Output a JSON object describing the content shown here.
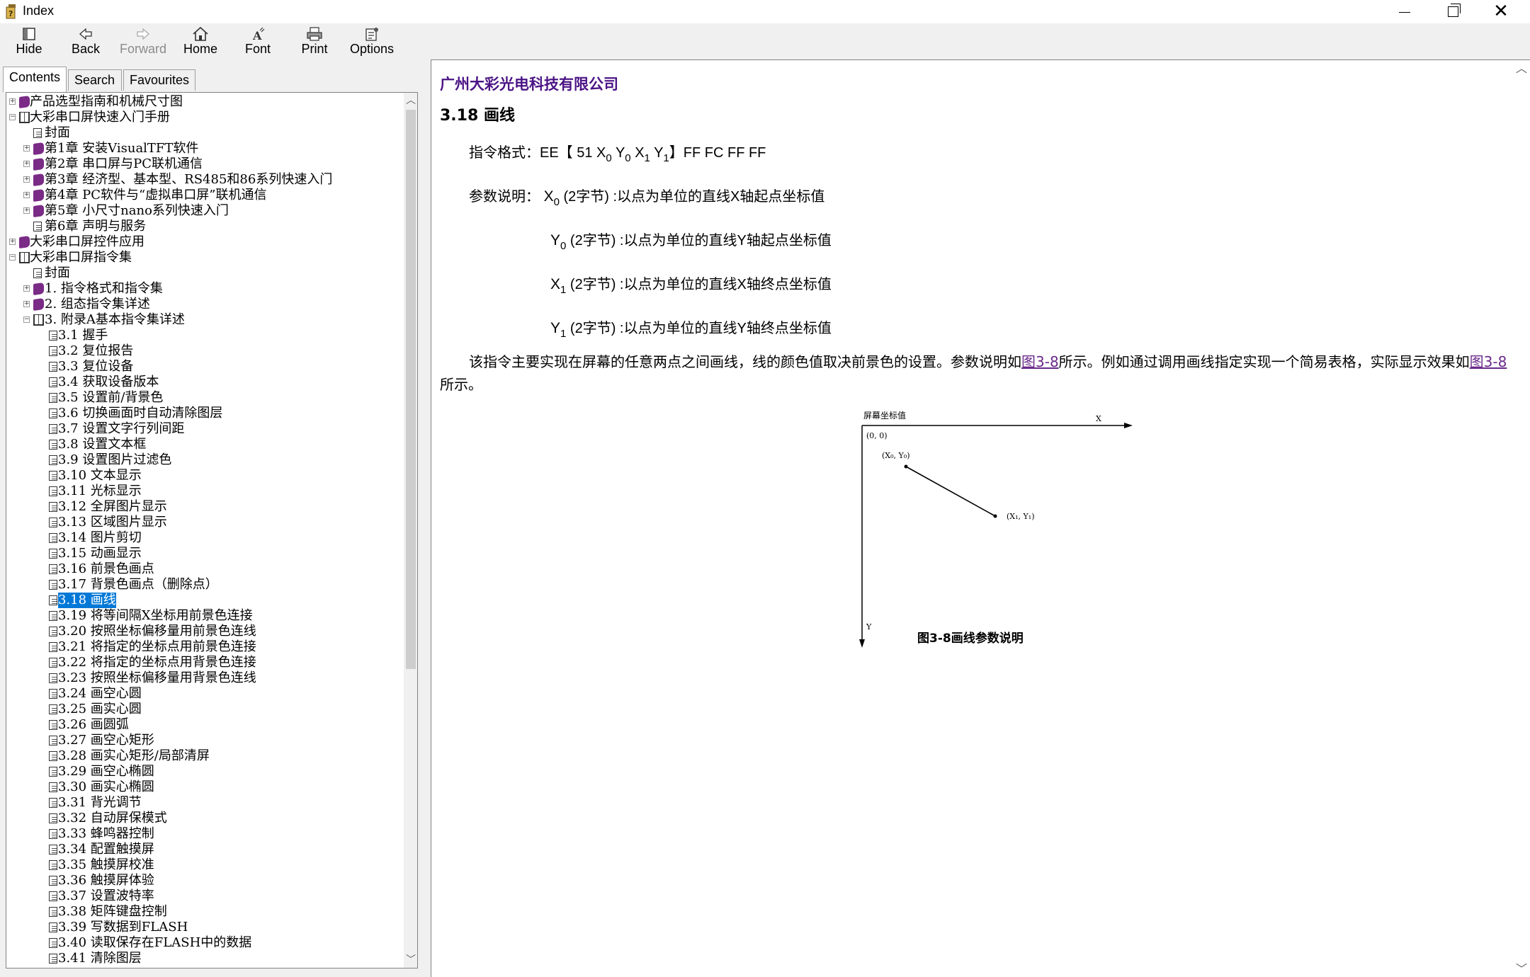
{
  "window": {
    "title": "Index",
    "colors": {
      "accent": "#0078d7",
      "link": "#6a2a8a",
      "company": "#4b1485",
      "book": "#7a2b86"
    }
  },
  "toolbar": {
    "hide": "Hide",
    "back": "Back",
    "forward": "Forward",
    "home": "Home",
    "font": "Font",
    "print": "Print",
    "options": "Options"
  },
  "tabs": {
    "contents": "Contents",
    "search": "Search",
    "favourites": "Favourites"
  },
  "tree": [
    {
      "label": "产品选型指南和机械尺寸图",
      "level": 0,
      "expander": "+",
      "icon": "book-closed"
    },
    {
      "label": "大彩串口屏快速入门手册",
      "level": 0,
      "expander": "-",
      "icon": "book-open"
    },
    {
      "label": "封面",
      "level": 1,
      "expander": "",
      "icon": "page"
    },
    {
      "label": "第1章 安装VisualTFT软件",
      "level": 1,
      "expander": "+",
      "icon": "book-closed"
    },
    {
      "label": "第2章 串口屏与PC联机通信",
      "level": 1,
      "expander": "+",
      "icon": "book-closed"
    },
    {
      "label": "第3章 经济型、基本型、RS485和86系列快速入门",
      "level": 1,
      "expander": "+",
      "icon": "book-closed"
    },
    {
      "label": "第4章 PC软件与“虚拟串口屏”联机通信",
      "level": 1,
      "expander": "+",
      "icon": "book-closed"
    },
    {
      "label": "第5章 小尺寸nano系列快速入门",
      "level": 1,
      "expander": "+",
      "icon": "book-closed"
    },
    {
      "label": "第6章 声明与服务",
      "level": 1,
      "expander": "",
      "icon": "page"
    },
    {
      "label": "大彩串口屏控件应用",
      "level": 0,
      "expander": "+",
      "icon": "book-closed"
    },
    {
      "label": "大彩串口屏指令集",
      "level": 0,
      "expander": "-",
      "icon": "book-open"
    },
    {
      "label": "封面",
      "level": 1,
      "expander": "",
      "icon": "page"
    },
    {
      "label": "1. 指令格式和指令集",
      "level": 1,
      "expander": "+",
      "icon": "book-closed"
    },
    {
      "label": "2. 组态指令集详述",
      "level": 1,
      "expander": "+",
      "icon": "book-closed"
    },
    {
      "label": "3. 附录A基本指令集详述",
      "level": 1,
      "expander": "-",
      "icon": "book-open"
    },
    {
      "label": "3.1 握手",
      "level": 2,
      "expander": "",
      "icon": "page"
    },
    {
      "label": "3.2 复位报告",
      "level": 2,
      "expander": "",
      "icon": "page"
    },
    {
      "label": "3.3 复位设备",
      "level": 2,
      "expander": "",
      "icon": "page"
    },
    {
      "label": "3.4 获取设备版本",
      "level": 2,
      "expander": "",
      "icon": "page"
    },
    {
      "label": "3.5 设置前/背景色",
      "level": 2,
      "expander": "",
      "icon": "page"
    },
    {
      "label": "3.6 切换画面时自动清除图层",
      "level": 2,
      "expander": "",
      "icon": "page"
    },
    {
      "label": "3.7 设置文字行列间距",
      "level": 2,
      "expander": "",
      "icon": "page"
    },
    {
      "label": "3.8 设置文本框",
      "level": 2,
      "expander": "",
      "icon": "page"
    },
    {
      "label": "3.9 设置图片过滤色",
      "level": 2,
      "expander": "",
      "icon": "page"
    },
    {
      "label": "3.10 文本显示",
      "level": 2,
      "expander": "",
      "icon": "page"
    },
    {
      "label": "3.11 光标显示",
      "level": 2,
      "expander": "",
      "icon": "page"
    },
    {
      "label": "3.12 全屏图片显示",
      "level": 2,
      "expander": "",
      "icon": "page"
    },
    {
      "label": "3.13 区域图片显示",
      "level": 2,
      "expander": "",
      "icon": "page"
    },
    {
      "label": "3.14 图片剪切",
      "level": 2,
      "expander": "",
      "icon": "page"
    },
    {
      "label": "3.15 动画显示",
      "level": 2,
      "expander": "",
      "icon": "page"
    },
    {
      "label": "3.16 前景色画点",
      "level": 2,
      "expander": "",
      "icon": "page"
    },
    {
      "label": "3.17 背景色画点（删除点）",
      "level": 2,
      "expander": "",
      "icon": "page"
    },
    {
      "label": "3.18 画线",
      "level": 2,
      "expander": "",
      "icon": "page",
      "selected": true
    },
    {
      "label": "3.19 将等间隔X坐标用前景色连接",
      "level": 2,
      "expander": "",
      "icon": "page"
    },
    {
      "label": "3.20 按照坐标偏移量用前景色连线",
      "level": 2,
      "expander": "",
      "icon": "page"
    },
    {
      "label": "3.21 将指定的坐标点用前景色连接",
      "level": 2,
      "expander": "",
      "icon": "page"
    },
    {
      "label": "3.22 将指定的坐标点用背景色连接",
      "level": 2,
      "expander": "",
      "icon": "page"
    },
    {
      "label": "3.23 按照坐标偏移量用背景色连线",
      "level": 2,
      "expander": "",
      "icon": "page"
    },
    {
      "label": "3.24 画空心圆",
      "level": 2,
      "expander": "",
      "icon": "page"
    },
    {
      "label": "3.25 画实心圆",
      "level": 2,
      "expander": "",
      "icon": "page"
    },
    {
      "label": "3.26 画圆弧",
      "level": 2,
      "expander": "",
      "icon": "page"
    },
    {
      "label": "3.27 画空心矩形",
      "level": 2,
      "expander": "",
      "icon": "page"
    },
    {
      "label": "3.28 画实心矩形/局部清屏",
      "level": 2,
      "expander": "",
      "icon": "page"
    },
    {
      "label": "3.29 画空心椭圆",
      "level": 2,
      "expander": "",
      "icon": "page"
    },
    {
      "label": "3.30 画实心椭圆",
      "level": 2,
      "expander": "",
      "icon": "page"
    },
    {
      "label": "3.31 背光调节",
      "level": 2,
      "expander": "",
      "icon": "page"
    },
    {
      "label": "3.32 自动屏保模式",
      "level": 2,
      "expander": "",
      "icon": "page"
    },
    {
      "label": "3.33 蜂鸣器控制",
      "level": 2,
      "expander": "",
      "icon": "page"
    },
    {
      "label": "3.34 配置触摸屏",
      "level": 2,
      "expander": "",
      "icon": "page"
    },
    {
      "label": "3.35 触摸屏校准",
      "level": 2,
      "expander": "",
      "icon": "page"
    },
    {
      "label": "3.36 触摸屏体验",
      "level": 2,
      "expander": "",
      "icon": "page"
    },
    {
      "label": "3.37 设置波特率",
      "level": 2,
      "expander": "",
      "icon": "page"
    },
    {
      "label": "3.38 矩阵键盘控制",
      "level": 2,
      "expander": "",
      "icon": "page"
    },
    {
      "label": "3.39 写数据到FLASH",
      "level": 2,
      "expander": "",
      "icon": "page"
    },
    {
      "label": "3.40 读取保存在FLASH中的数据",
      "level": 2,
      "expander": "",
      "icon": "page"
    },
    {
      "label": "3.41 清除图层",
      "level": 2,
      "expander": "",
      "icon": "page"
    }
  ],
  "content": {
    "company": "广州大彩光电科技有限公司",
    "section_title": "3.18  画线",
    "cmd_label": "指令格式：",
    "cmd_prefix": "EE【 51",
    "cmd_suffix": "】FF FC FF FF",
    "param_label": "参数说明：",
    "var_x": "X",
    "var_y": "Y",
    "sub_0": "0",
    "sub_1": "1",
    "param_x0_desc": "(2字节) :以点为单位的直线X轴起点坐标值",
    "param_y0_desc": "(2字节) :以点为单位的直线Y轴起点坐标值",
    "param_x1_desc": "(2字节) :以点为单位的直线X轴终点坐标值",
    "param_y1_desc": "(2字节) :以点为单位的直线Y轴终点坐标值",
    "desc_part1": "该指令主要实现在屏幕的任意两点之间画线，线的颜色值取决前景色的设置。参数说明如",
    "desc_link1": "图3-8",
    "desc_part2": "所示。例如通过调用画线指定实现一个简易表格，实际显示效果如",
    "desc_link2": "图3-8",
    "desc_part3": "所示。",
    "figure": {
      "screen_coord_label": "屏幕坐标值",
      "origin_label": "(0, 0)",
      "x_axis_label": "X",
      "y_axis_label": "Y",
      "start_point_label": "(X₀, Y₀)",
      "end_point_label": "(X₁, Y₁)"
    },
    "figure_caption": "图3-8画线参数说明"
  }
}
